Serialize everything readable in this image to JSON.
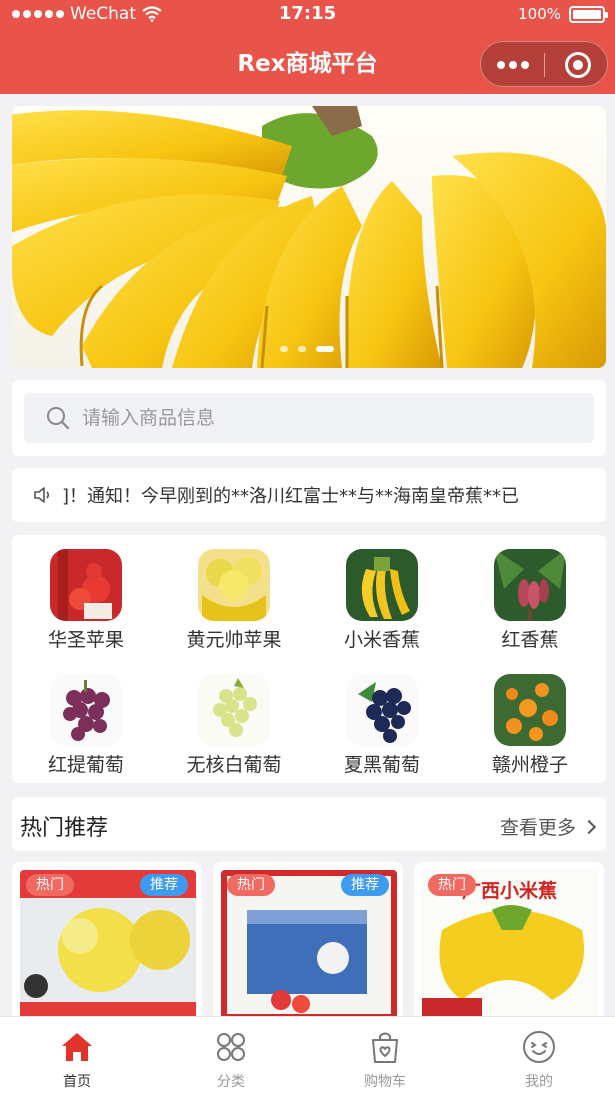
{
  "status_bar": {
    "carrier": "WeChat",
    "time": "17:15",
    "battery": "100%"
  },
  "nav": {
    "title": "Rex商城平台"
  },
  "banner": {
    "image": "banana-bunch",
    "slide_count": 3,
    "active_slide": 3
  },
  "search": {
    "placeholder": "请输入商品信息",
    "value": ""
  },
  "notice": {
    "icon": "speaker-icon",
    "text": "]！通知！今早刚到的**洛川红富士**与**海南皇帝蕉**已"
  },
  "categories": [
    {
      "label": "华圣苹果",
      "image": "red-apple"
    },
    {
      "label": "黄元帅苹果",
      "image": "yellow-apple"
    },
    {
      "label": "小米香蕉",
      "image": "small-banana"
    },
    {
      "label": "红香蕉",
      "image": "red-banana"
    },
    {
      "label": "红提葡萄",
      "image": "red-grape"
    },
    {
      "label": "无核白葡萄",
      "image": "green-grape"
    },
    {
      "label": "夏黑葡萄",
      "image": "black-grape"
    },
    {
      "label": "赣州橙子",
      "image": "orange"
    }
  ],
  "hot": {
    "title": "热门推荐",
    "more_label": "查看更多",
    "products": [
      {
        "hot_badge": "热门",
        "rec_badge": "推荐",
        "image": "yellow-apple-product"
      },
      {
        "hot_badge": "热门",
        "rec_badge": "推荐",
        "image": "gift-box-product"
      },
      {
        "hot_badge": "热门",
        "rec_badge": "",
        "image": "banana-product",
        "overlay_text": "广西小米蕉"
      }
    ]
  },
  "tabbar": [
    {
      "label": "首页",
      "icon": "home-icon",
      "active": true
    },
    {
      "label": "分类",
      "icon": "category-icon",
      "active": false
    },
    {
      "label": "购物车",
      "icon": "cart-bag-icon",
      "active": false
    },
    {
      "label": "我的",
      "icon": "smiley-icon",
      "active": false
    }
  ],
  "colors": {
    "brand": "#e8534a",
    "hot_badge": "#f06a62",
    "rec_badge": "#3f9bf0"
  }
}
